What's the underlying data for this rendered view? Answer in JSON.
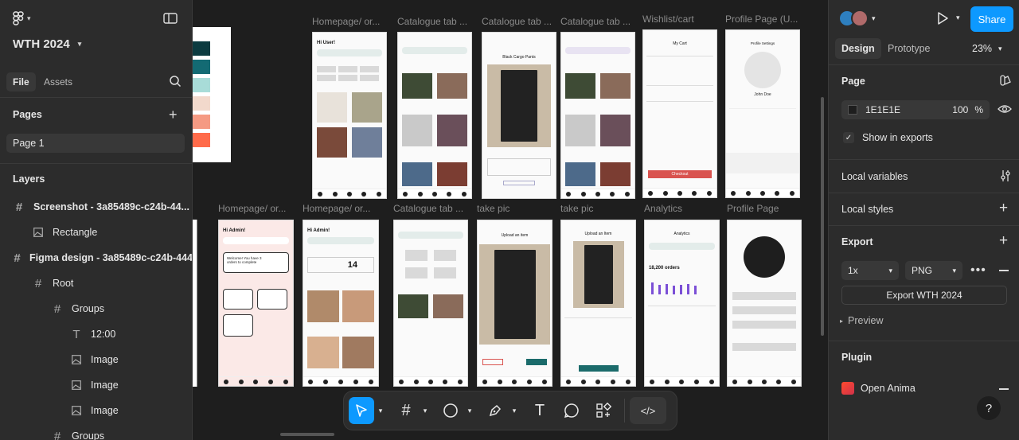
{
  "left": {
    "file_name": "WTH 2024",
    "tabs": {
      "file": "File",
      "assets": "Assets"
    },
    "pages_heading": "Pages",
    "pages": [
      "Page 1"
    ],
    "layers_heading": "Layers",
    "layers": [
      {
        "label": "Screenshot - 3a85489c-c24b-44...",
        "icon": "frame-icon"
      },
      {
        "label": "Rectangle",
        "icon": "image-icon"
      },
      {
        "label": "Figma design - 3a85489c-c24b-444",
        "icon": "frame-icon"
      },
      {
        "label": "Root",
        "icon": "frame-icon"
      },
      {
        "label": "Groups",
        "icon": "frame-icon"
      },
      {
        "label": "12:00",
        "icon": "text-icon"
      },
      {
        "label": "Image",
        "icon": "image-icon"
      },
      {
        "label": "Image",
        "icon": "image-icon"
      },
      {
        "label": "Image",
        "icon": "image-icon"
      },
      {
        "label": "Groups",
        "icon": "frame-icon"
      }
    ]
  },
  "canvas": {
    "frames_row1": [
      {
        "label": "Homepage/ or...",
        "title": "Hi User!"
      },
      {
        "label": "Catalogue tab ...",
        "title": "Search"
      },
      {
        "label": "Catalogue tab ...",
        "title": "Black Cargo Pants"
      },
      {
        "label": "Catalogue tab ...",
        "title": "Search"
      },
      {
        "label": "Wishlist/cart",
        "title": "My Cart"
      },
      {
        "label": "Profile Page (U...",
        "title": "Profile Settings"
      }
    ],
    "frames_row2": [
      {
        "label": "Homepage/ or...",
        "title": "Hi Admin!"
      },
      {
        "label": "Homepage/ or...",
        "title": "Hi Admin!"
      },
      {
        "label": "Catalogue tab ...",
        "title": "Search"
      },
      {
        "label": "take pic",
        "title": "Upload an item"
      },
      {
        "label": "take pic",
        "title": "Upload an Item"
      },
      {
        "label": "Analytics",
        "title": "Analytics"
      },
      {
        "label": "Profile Page",
        "title": ""
      }
    ],
    "cart_checkout": "Checkout",
    "profile_name": "John Doe",
    "analytics_orders": "18,200 orders",
    "admin_orders_count": "14",
    "admin_welcome": "Welcome! You have 3 orders to complete"
  },
  "toolbar": {
    "code_label": "</>"
  },
  "right": {
    "tabs": {
      "design": "Design",
      "prototype": "Prototype"
    },
    "zoom": "23%",
    "share": "Share",
    "page_heading": "Page",
    "page_color": "1E1E1E",
    "page_opacity": "100",
    "page_opacity_unit": "%",
    "show_in_exports": "Show in exports",
    "local_variables": "Local variables",
    "local_styles": "Local styles",
    "export_heading": "Export",
    "export_scale": "1x",
    "export_format": "PNG",
    "export_button": "Export WTH 2024",
    "preview": "Preview",
    "plugin_heading": "Plugin",
    "plugin_name": "Open Anima",
    "help": "?"
  },
  "colors": {
    "accent": "#0d99ff",
    "palette": [
      "#0c3b40",
      "#136a73",
      "#a8dcd8",
      "#f2d9cc",
      "#f59a83",
      "#ff6b4a"
    ]
  }
}
